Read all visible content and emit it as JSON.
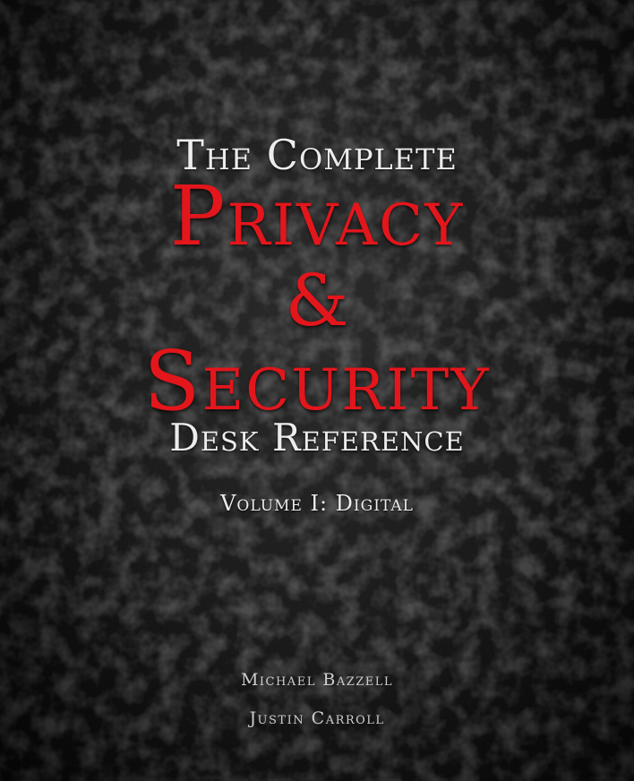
{
  "cover": {
    "pre_title": "The Complete",
    "title_line1": "Privacy",
    "ampersand": "&",
    "title_line2": "Security",
    "subtitle": "Desk Reference",
    "volume": "Volume I: Digital",
    "authors": [
      "Michael Bazzell",
      "Justin Carroll"
    ]
  },
  "colors": {
    "background": "#141414",
    "title_red": "#e3161c",
    "text_white": "#ececec"
  }
}
